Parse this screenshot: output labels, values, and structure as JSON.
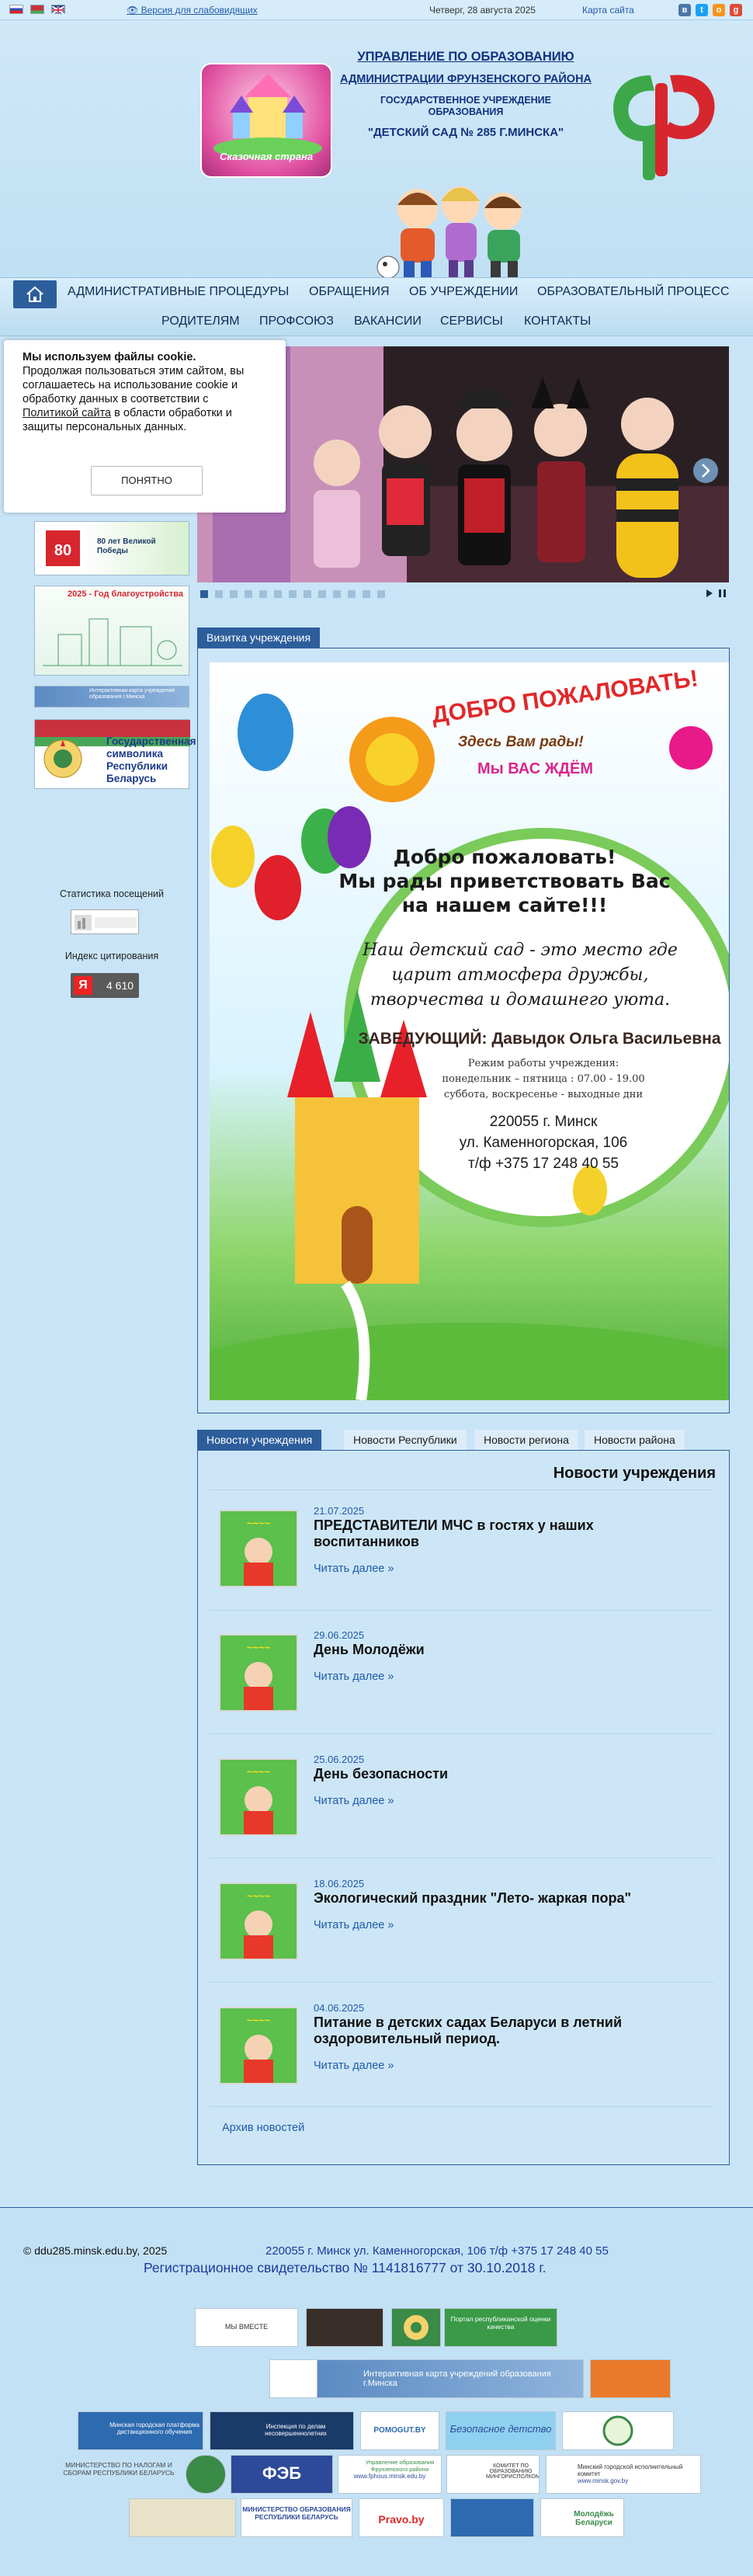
{
  "topbar": {
    "low_vision_link": "Версия для слабовидящих",
    "date": "Четверг, 28 августа 2025",
    "sitemap_link": "Карта сайта"
  },
  "header": {
    "logo_text": "Сказочная страна",
    "line1": "УПРАВЛЕНИЕ ПО ОБРАЗОВАНИЮ",
    "line2": "АДМИНИСТРАЦИИ ФРУНЗЕНСКОГО РАЙОНА",
    "line3": "ГОСУДАРСТВЕННОЕ УЧРЕЖДЕНИЕ",
    "line4": "ОБРАЗОВАНИЯ",
    "line5": "\"ДЕТСКИЙ САД № 285 Г.МИНСКА\""
  },
  "nav": {
    "row1": [
      "АДМИНИСТРАТИВНЫЕ ПРОЦЕДУРЫ",
      "ОБРАЩЕНИЯ",
      "ОБ УЧРЕЖДЕНИИ",
      "ОБРАЗОВАТЕЛЬНЫЙ ПРОЦЕСС"
    ],
    "row2": [
      "РОДИТЕЛЯМ",
      "ПРОФСОЮЗ",
      "ВАКАНСИИ",
      "СЕРВИСЫ",
      "КОНТАКТЫ"
    ]
  },
  "cookie": {
    "title": "Мы используем файлы cookie.",
    "text_before": "Продолжая пользоваться этим сайтом, вы соглашаетесь на использование cookie и обработку данных в соответствии с ",
    "link": "Политикой сайта",
    "text_after": " в области обработки и защиты персональных данных.",
    "button": "ПОНЯТНО"
  },
  "sidebar": {
    "banner_1": "80 лет Великой Победы",
    "banner_2": "2025 - Год благоустройства",
    "banner_3": "Интерактивная карта учреждений образования г.Минска",
    "banner_4": "Государственная символика Республики Беларусь",
    "stats_label": "Статистика посещений",
    "citation_label": "Индекс цитирования",
    "citation_value": "4 610"
  },
  "visit_card": {
    "tab": "Визитка учреждения",
    "banner_top": "ДОБРО ПОЖАЛОВАТЬ!",
    "banner_sub": "Здесь Вам рады!",
    "banner_sub2": "Мы ВАС ЖДЁМ",
    "welcome1": "Добро пожаловать!",
    "welcome2": "Мы рады приветствовать Вас",
    "welcome3": "на нашем сайте!!!",
    "motto1": "Наш детский сад  - это место где",
    "motto2": "царит атмосфера дружбы,",
    "motto3": "творчества  и  домашнего уюта.",
    "head": "ЗАВЕДУЮЩИЙ: Давыдок Ольга Васильевна",
    "hours1": "Режим работы учреждения:",
    "hours2": "понедельник – пятница : 07.00 - 19.00",
    "hours3": "суббота, воскресенье - выходные дни",
    "addr1": "220055  г. Минск",
    "addr2": "ул. Каменногорская,  106",
    "phone": "т/ф +375 17 248 40 55"
  },
  "news": {
    "tabs": [
      "Новости учреждения",
      "Новости Республики",
      "Новости региона",
      "Новости района"
    ],
    "heading": "Новости учреждения",
    "more_label": "Читать далее »",
    "items": [
      {
        "date": "21.07.2025",
        "title": "ПРЕДСТАВИТЕЛИ МЧС в гостях у наших воспитанников"
      },
      {
        "date": "29.06.2025",
        "title": "День Молодёжи"
      },
      {
        "date": "25.06.2025",
        "title": "День безопасности"
      },
      {
        "date": "18.06.2025",
        "title": "Экологический праздник \"Лето- жаркая пора\""
      },
      {
        "date": "04.06.2025",
        "title": "Питание в детских садах Беларуси в летний оздоровительный период."
      }
    ],
    "archive": "Архив новостей"
  },
  "footer": {
    "copyright": "© ddu285.minsk.edu.by, 2025",
    "address": "220055 г. Минск ул. Каменногорская, 106 т/ф +375 17 248 40 55",
    "registration": "Регистрационное свидетельство № 1141816777 от 30.10.2018 г.",
    "logos": [
      "МЫ ВМЕСТЕ",
      "Портал республиканской оценки качества",
      "Интерактивная карта учреждений образования г.Минска",
      "Минская городская платформа дистанционного обучения",
      "Инспекция по делам несовершеннолетних",
      "POMOGUT.BY",
      "Безопасное детство",
      "МИНИСТЕРСТВО ПО НАЛОГАМ И СБОРАМ РЕСПУБЛИКИ БЕЛАРУСЬ",
      "ФЭБ",
      "Управление образования Фрунзенского района",
      "КОМИТЕТ ПО ОБРАЗОВАНИЮ МИНГОРИСПОЛКОМА",
      "Минский городской исполнительный комитет",
      "МИНИСТЕРСТВО ОБРАЗОВАНИЯ РЕСПУБЛИКИ БЕЛАРУСЬ",
      "Pravo.by",
      "Молодёжь Беларуси"
    ],
    "logo_sites": [
      "www.fphous.minsk.edu.by",
      "www.minsk.gov.by"
    ]
  }
}
